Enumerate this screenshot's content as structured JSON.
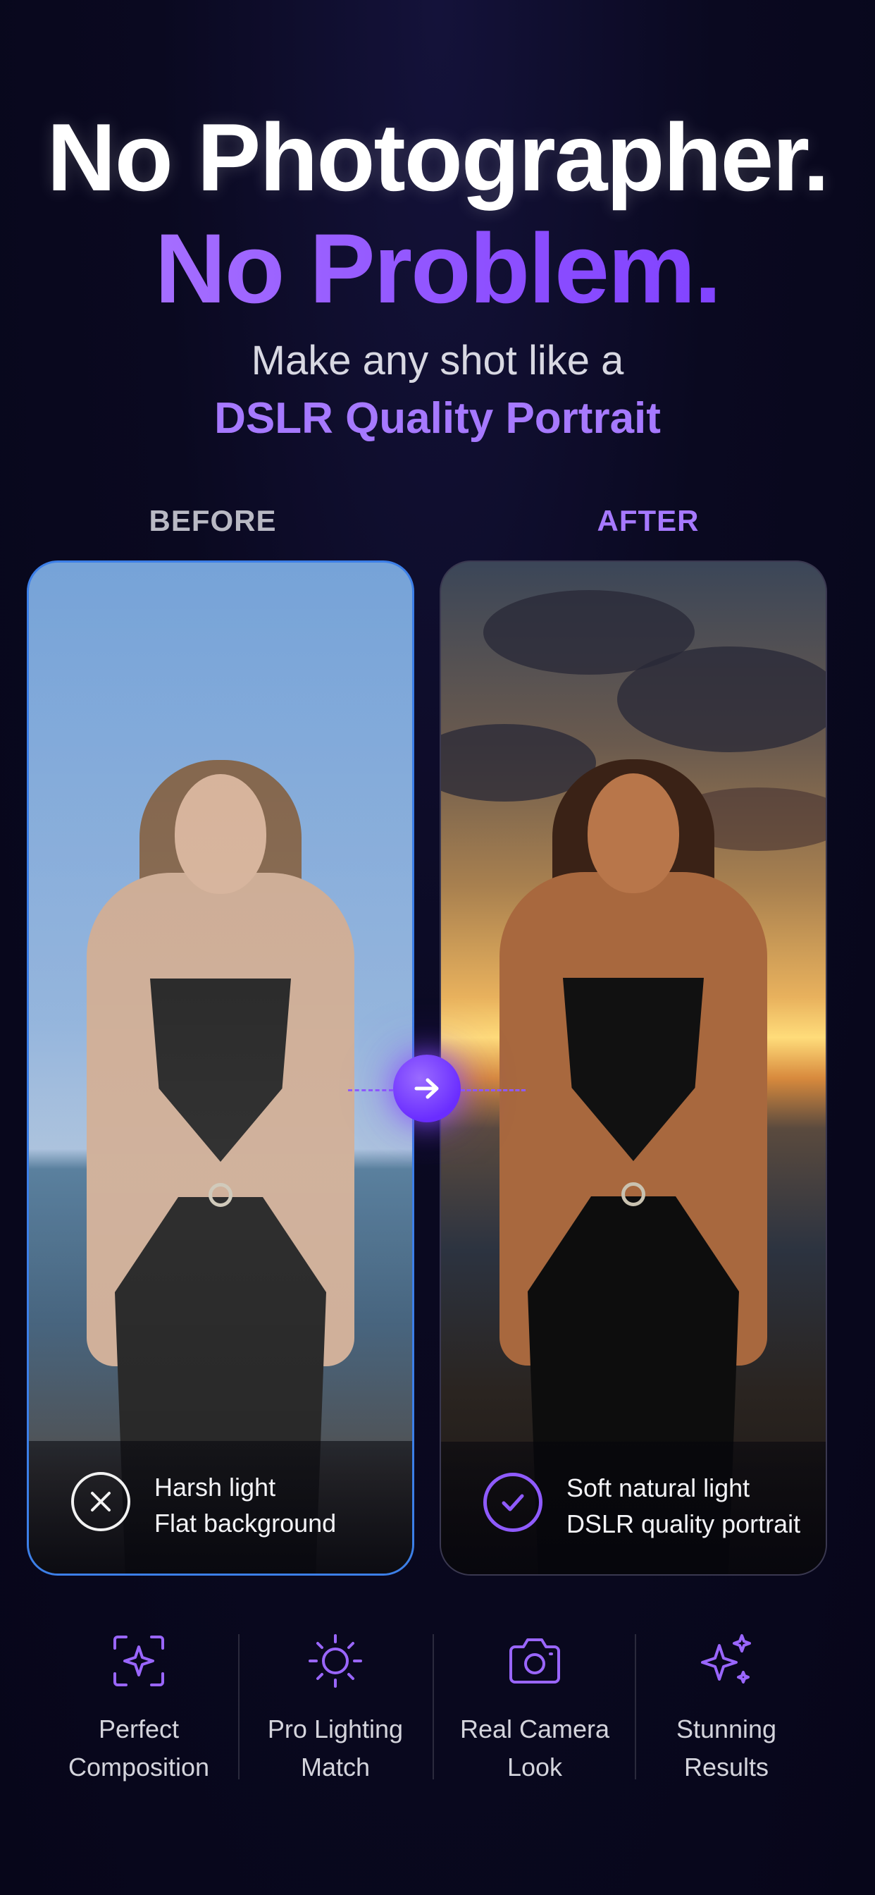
{
  "headline": {
    "line1": "No Photographer.",
    "line2": "No Problem."
  },
  "subheadline": {
    "line1": "Make any shot like a",
    "line2": "DSLR Quality Portrait"
  },
  "comparison": {
    "before_label": "BEFORE",
    "after_label": "AFTER",
    "before": {
      "line1": "Harsh light",
      "line2": "Flat background",
      "icon": "x-circle-icon"
    },
    "after": {
      "line1": "Soft natural light",
      "line2": "DSLR quality portrait",
      "icon": "check-circle-icon"
    },
    "arrow_icon": "arrow-right-icon"
  },
  "features": [
    {
      "icon": "composition-frame-icon",
      "line1": "Perfect",
      "line2": "Composition"
    },
    {
      "icon": "sun-icon",
      "line1": "Pro Lighting",
      "line2": "Match"
    },
    {
      "icon": "camera-icon",
      "line1": "Real Camera",
      "line2": "Look"
    },
    {
      "icon": "sparkles-icon",
      "line1": "Stunning",
      "line2": "Results"
    }
  ],
  "colors": {
    "background": "#08071a",
    "accent": "#8f5bff",
    "before_border": "#3c7fe8",
    "text": "#ffffff"
  }
}
